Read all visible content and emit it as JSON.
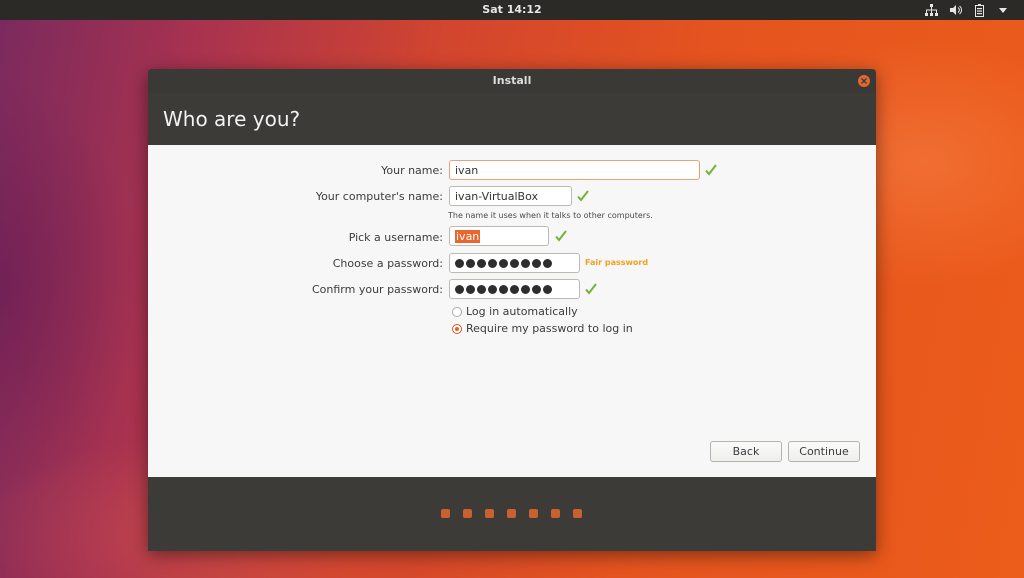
{
  "topbar": {
    "clock": "Sat 14:12",
    "icons": [
      "network-icon",
      "volume-icon",
      "battery-icon",
      "chevron-down-icon"
    ]
  },
  "window": {
    "title": "Install",
    "heading": "Who are you?"
  },
  "form": {
    "name": {
      "label": "Your name:",
      "value": "ivan"
    },
    "computer": {
      "label": "Your computer's name:",
      "value": "ivan-VirtualBox",
      "hint": "The name it uses when it talks to other computers."
    },
    "username": {
      "label": "Pick a username:",
      "value": "ivan"
    },
    "password": {
      "label": "Choose a password:",
      "dot_count": 9,
      "strength": "Fair password"
    },
    "confirm": {
      "label": "Confirm your password:",
      "dot_count": 9
    },
    "login_options": [
      {
        "label": "Log in automatically",
        "selected": false
      },
      {
        "label": "Require my password to log in",
        "selected": true
      }
    ]
  },
  "buttons": {
    "back": "Back",
    "continue": "Continue"
  },
  "progress": {
    "steps": 7
  },
  "colors": {
    "accent": "#e2672e",
    "check": "#73b33b",
    "strength": "#f0a020",
    "panel": "#3c3b37"
  }
}
